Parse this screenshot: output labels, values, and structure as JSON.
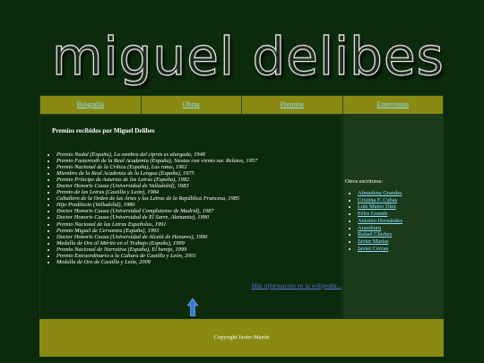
{
  "header": {
    "title": "miguel delibes"
  },
  "nav": [
    "Biografía",
    "Obras",
    "Premios",
    "Entrevistas"
  ],
  "main": {
    "title": "Premios recibidos por Miguel Delibes",
    "awards": [
      "Premio Nadal (España), La sombra del ciprés es alargada, 1948",
      "Premio Fastenrath de la Real Academia (España), Siestas con viento sur. Relatos, 1957",
      "Premio Nacional de la Crítica (España), Las ratas, 1962",
      "Miembro de la Real Academia de la Lengua (España), 1975",
      "Premio Príncipe de Asturias de las Letras (España), 1982",
      "Doctor Honoris Causa (Universidad de Valladolid), 1983",
      "Premio de las Letras (Castilla y León), 1984",
      "Caballero de la Orden de las Artes y las Letras de la República Francesa, 1985",
      "Hijo Predilecto (Valladolid), 1986",
      "Doctor Honoris Causa (Universidad Complutense de Madrid), 1987",
      "Doctor Honoris Causa (Universidad de El Sarre, Alemania), 1990",
      "Premio Nacional de las Letras Españolas, 1991",
      "Premio Miguel de Cervantes (España), 1993",
      "Doctor Honoris Causa (Universidad de Alcalá de Henares), 1996",
      "Medalla de Oro al Mérito en el Trabajo (España), 1999",
      "Premio Nacional de Narrativa (España), El hereje, 1999",
      "Premio Extraordinario a la Cultura de Castilla y León, 2001",
      "Medalla de Oro de Castilla y León, 2009"
    ],
    "wiki_link": "Más información en la wikipedia..."
  },
  "side": {
    "label": "Otros escritores:",
    "writers": [
      "Almudena Grandes",
      "Cristina F. Cubas",
      "Luis Mateo Díez",
      "Félix Grande",
      "Antonio Hernández",
      "Aramburu",
      "Rafael Chirbes",
      "Javier Marías",
      "Javier Cercas"
    ]
  },
  "footer": {
    "text": "Copyright Javier Martín"
  },
  "icons": {
    "up": "up-arrow-icon"
  }
}
